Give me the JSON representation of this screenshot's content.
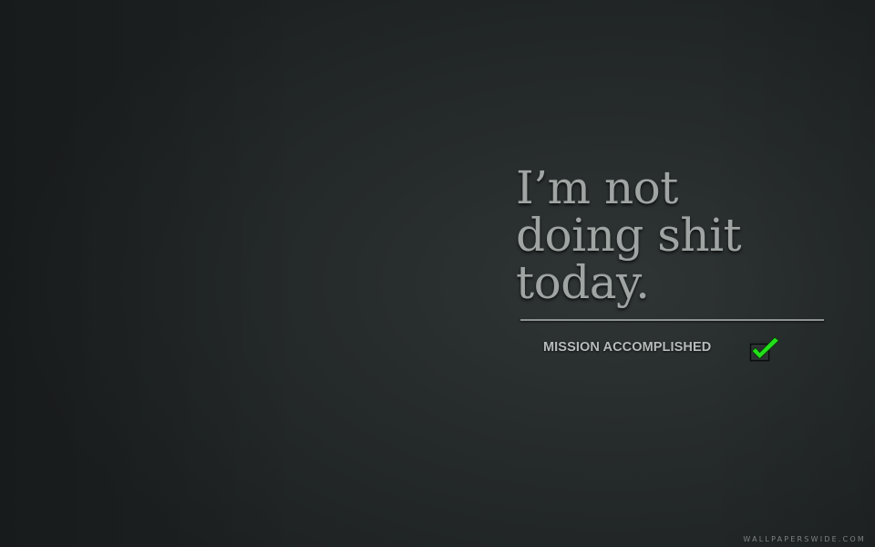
{
  "quote": {
    "lines": [
      "I’m not",
      "doing shit",
      "today."
    ]
  },
  "status": {
    "label": "MISSION ACCOMPLISHED",
    "checked": true,
    "check_color": "#22e01a",
    "icon": "checkmark-icon"
  },
  "watermark": {
    "text": "WALLPAPERSWIDE.COM"
  },
  "colors": {
    "background": "#262b2b",
    "text": "#9fa5a3",
    "check": "#22e01a"
  }
}
